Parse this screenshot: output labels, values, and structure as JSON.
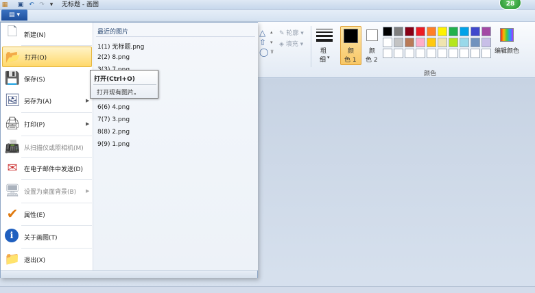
{
  "window": {
    "title": "无标题 - 画图"
  },
  "badge": {
    "count": "28"
  },
  "quick_access": {
    "save": "save-icon",
    "undo": "undo-icon",
    "redo": "redo-icon",
    "customize": "▾"
  },
  "file_tab": {
    "icon": "▤",
    "arrow": "▾"
  },
  "ribbon": {
    "outline_label": "轮廓",
    "fill_label": "填充",
    "size_label_1": "粗",
    "size_label_2": "细",
    "color1_line1": "颜",
    "color1_line2": "色 1",
    "color2_line1": "颜",
    "color2_line2": "色 2",
    "edit_colors_label": "编辑颜色",
    "colors_group_label": "颜色",
    "palette": [
      "#000000",
      "#7f7f7f",
      "#880015",
      "#ed1c24",
      "#ff7f27",
      "#fff200",
      "#22b14c",
      "#00a2e8",
      "#3f48cc",
      "#a349a4",
      "#ffffff",
      "#c3c3c3",
      "#b97a57",
      "#ffaec9",
      "#ffc90e",
      "#efe4b0",
      "#b5e61d",
      "#99d9ea",
      "#7092be",
      "#c8bfe7",
      "#ffffff",
      "#ffffff",
      "#ffffff",
      "#ffffff",
      "#ffffff",
      "#ffffff",
      "#ffffff",
      "#ffffff",
      "#ffffff",
      "#ffffff"
    ]
  },
  "menu": {
    "items": [
      {
        "label": "新建(N)",
        "icon": "new-icon",
        "glyph": "🗋"
      },
      {
        "label": "打开(O)",
        "icon": "open-folder-icon",
        "glyph": "📂"
      },
      {
        "label": "保存(S)",
        "icon": "save-icon",
        "glyph": "💾"
      },
      {
        "label": "另存为(A)",
        "icon": "save-as-icon",
        "glyph": "🖼"
      },
      {
        "label": "打印(P)",
        "icon": "printer-icon",
        "glyph": "🖨"
      },
      {
        "label": "从扫描仪或照相机(M)",
        "icon": "scanner-icon",
        "glyph": "📠"
      },
      {
        "label": "在电子邮件中发送(D)",
        "icon": "email-icon",
        "glyph": "✉"
      },
      {
        "label": "设置为桌面背景(B)",
        "icon": "desktop-background-icon",
        "glyph": "🖥"
      },
      {
        "label": "属性(E)",
        "icon": "checkmark-icon",
        "glyph": "✔"
      },
      {
        "label": "关于画图(T)",
        "icon": "info-icon",
        "glyph": "ℹ"
      },
      {
        "label": "退出(X)",
        "icon": "exit-icon",
        "glyph": "📁"
      }
    ],
    "recent_title": "最近的图片",
    "recent": [
      "1(1) 无标题.png",
      "2(2) 8.png",
      "3(3) 7.png",
      "6(6) 4.png",
      "7(7) 3.png",
      "8(8) 2.png",
      "9(9) 1.png"
    ]
  },
  "tooltip": {
    "title": "打开(Ctrl+O)",
    "description": "打开现有图片。"
  }
}
